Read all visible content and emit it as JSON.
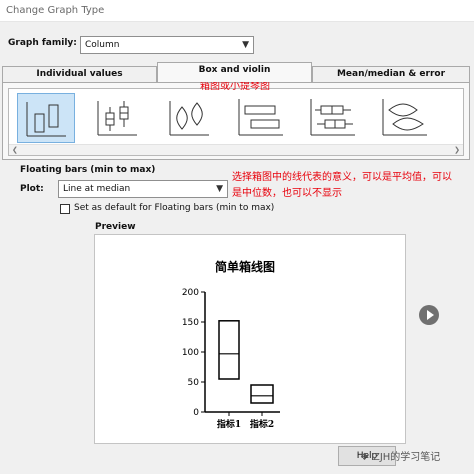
{
  "window": {
    "title": "Change Graph Type"
  },
  "graph_family": {
    "label": "Graph family:",
    "value": "Column"
  },
  "tabs": [
    {
      "label": "Individual values",
      "active": false
    },
    {
      "label": "Box and violin",
      "active": true
    },
    {
      "label": "Mean/median & error",
      "active": false
    }
  ],
  "gallery": {
    "selected_index": 0,
    "items": [
      {
        "icon": "column-floating-bars-icon"
      },
      {
        "icon": "column-box-whisker-icon"
      },
      {
        "icon": "column-violin-icon"
      },
      {
        "icon": "row-floating-bars-icon"
      },
      {
        "icon": "row-box-whisker-icon"
      },
      {
        "icon": "row-violin-icon"
      }
    ]
  },
  "annotations": {
    "tab_note": "箱图或小提琴图",
    "plot_note": "选择箱图中的线代表的意义，可以是平均值，可以是中位数，也可以不显示"
  },
  "floating_bars": {
    "title": "Floating bars (min to max)",
    "plot_label": "Plot:",
    "plot_value": "Line at median",
    "default_checkbox_label": "Set as default for Floating bars (min to max)",
    "default_checked": false
  },
  "preview": {
    "label": "Preview"
  },
  "chart_data": {
    "type": "bar",
    "title": "简单箱线图",
    "categories": [
      "指标1",
      "指标2"
    ],
    "y_ticks": [
      0,
      50,
      100,
      150,
      200
    ],
    "ylim": [
      0,
      200
    ],
    "series": [
      {
        "min": 55,
        "median": 97,
        "max": 152
      },
      {
        "min": 15,
        "median": 27,
        "max": 45
      }
    ]
  },
  "buttons": {
    "help": "Help"
  },
  "watermark": {
    "text": "ZJH的学习笔记"
  }
}
